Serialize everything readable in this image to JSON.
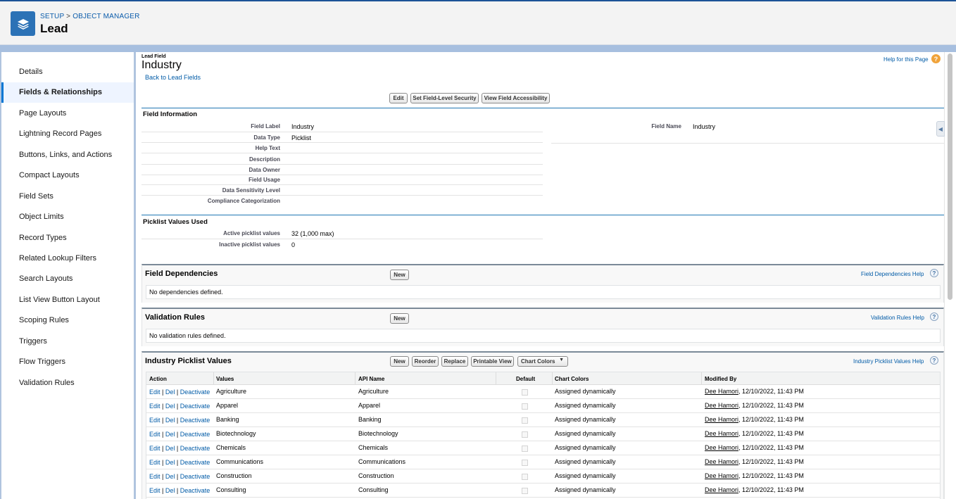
{
  "header": {
    "breadcrumb_setup": "SETUP",
    "breadcrumb_sep": ">",
    "breadcrumb_object_manager": "OBJECT MANAGER",
    "title": "Lead"
  },
  "sidebar": {
    "items": [
      {
        "label": "Details"
      },
      {
        "label": "Fields & Relationships"
      },
      {
        "label": "Page Layouts"
      },
      {
        "label": "Lightning Record Pages"
      },
      {
        "label": "Buttons, Links, and Actions"
      },
      {
        "label": "Compact Layouts"
      },
      {
        "label": "Field Sets"
      },
      {
        "label": "Object Limits"
      },
      {
        "label": "Record Types"
      },
      {
        "label": "Related Lookup Filters"
      },
      {
        "label": "Search Layouts"
      },
      {
        "label": "List View Button Layout"
      },
      {
        "label": "Scoping Rules"
      },
      {
        "label": "Triggers"
      },
      {
        "label": "Flow Triggers"
      },
      {
        "label": "Validation Rules"
      }
    ],
    "active": "Fields & Relationships"
  },
  "page": {
    "type_label": "Lead Field",
    "title": "Industry",
    "back_link": "Back to Lead Fields",
    "help_link": "Help for this Page",
    "buttons": {
      "edit": "Edit",
      "fls": "Set Field-Level Security",
      "access": "View Field Accessibility"
    }
  },
  "field_info": {
    "section_title": "Field Information",
    "rows": [
      {
        "label": "Field Label",
        "value": "Industry"
      },
      {
        "label": "Data Type",
        "value": "Picklist"
      },
      {
        "label": "Help Text",
        "value": ""
      },
      {
        "label": "Description",
        "value": ""
      },
      {
        "label": "Data Owner",
        "value": ""
      },
      {
        "label": "Field Usage",
        "value": ""
      },
      {
        "label": "Data Sensitivity Level",
        "value": ""
      },
      {
        "label": "Compliance Categorization",
        "value": ""
      }
    ],
    "field_name_label": "Field Name",
    "field_name_value": "Industry"
  },
  "picklist_used": {
    "section_title": "Picklist Values Used",
    "rows": [
      {
        "label": "Active picklist values",
        "value": "32 (1,000 max)"
      },
      {
        "label": "Inactive picklist values",
        "value": "0"
      }
    ]
  },
  "dependencies": {
    "title": "Field Dependencies",
    "new_button": "New",
    "help_link": "Field Dependencies Help",
    "empty_text": "No dependencies defined."
  },
  "validation": {
    "title": "Validation Rules",
    "new_button": "New",
    "help_link": "Validation Rules Help",
    "empty_text": "No validation rules defined."
  },
  "picklist_values": {
    "title": "Industry Picklist Values",
    "buttons": {
      "new": "New",
      "reorder": "Reorder",
      "replace": "Replace",
      "printable": "Printable View",
      "chart_colors": "Chart Colors"
    },
    "help_link": "Industry Picklist Values Help",
    "columns": [
      "Action",
      "Values",
      "API Name",
      "Default",
      "Chart Colors",
      "Modified By"
    ],
    "action_edit": "Edit",
    "action_sep": "|",
    "action_del": "Del",
    "action_deactivate": "Deactivate",
    "rows": [
      {
        "value": "Agriculture",
        "api": "Agriculture",
        "colors": "Assigned dynamically",
        "user": "Dee Hamori",
        "date": ", 12/10/2022, 11:43 PM"
      },
      {
        "value": "Apparel",
        "api": "Apparel",
        "colors": "Assigned dynamically",
        "user": "Dee Hamori",
        "date": ", 12/10/2022, 11:43 PM"
      },
      {
        "value": "Banking",
        "api": "Banking",
        "colors": "Assigned dynamically",
        "user": "Dee Hamori",
        "date": ", 12/10/2022, 11:43 PM"
      },
      {
        "value": "Biotechnology",
        "api": "Biotechnology",
        "colors": "Assigned dynamically",
        "user": "Dee Hamori",
        "date": ", 12/10/2022, 11:43 PM"
      },
      {
        "value": "Chemicals",
        "api": "Chemicals",
        "colors": "Assigned dynamically",
        "user": "Dee Hamori",
        "date": ", 12/10/2022, 11:43 PM"
      },
      {
        "value": "Communications",
        "api": "Communications",
        "colors": "Assigned dynamically",
        "user": "Dee Hamori",
        "date": ", 12/10/2022, 11:43 PM"
      },
      {
        "value": "Construction",
        "api": "Construction",
        "colors": "Assigned dynamically",
        "user": "Dee Hamori",
        "date": ", 12/10/2022, 11:43 PM"
      },
      {
        "value": "Consulting",
        "api": "Consulting",
        "colors": "Assigned dynamically",
        "user": "Dee Hamori",
        "date": ", 12/10/2022, 11:43 PM"
      }
    ]
  },
  "colors": {
    "brand": "#1b5297",
    "link": "#015ba7",
    "active_nav": "#eef4ff"
  },
  "icons": {
    "app": "layers-icon",
    "help_page": "help-circle-icon",
    "help": "question-icon",
    "dropdown": "caret-down-icon"
  }
}
